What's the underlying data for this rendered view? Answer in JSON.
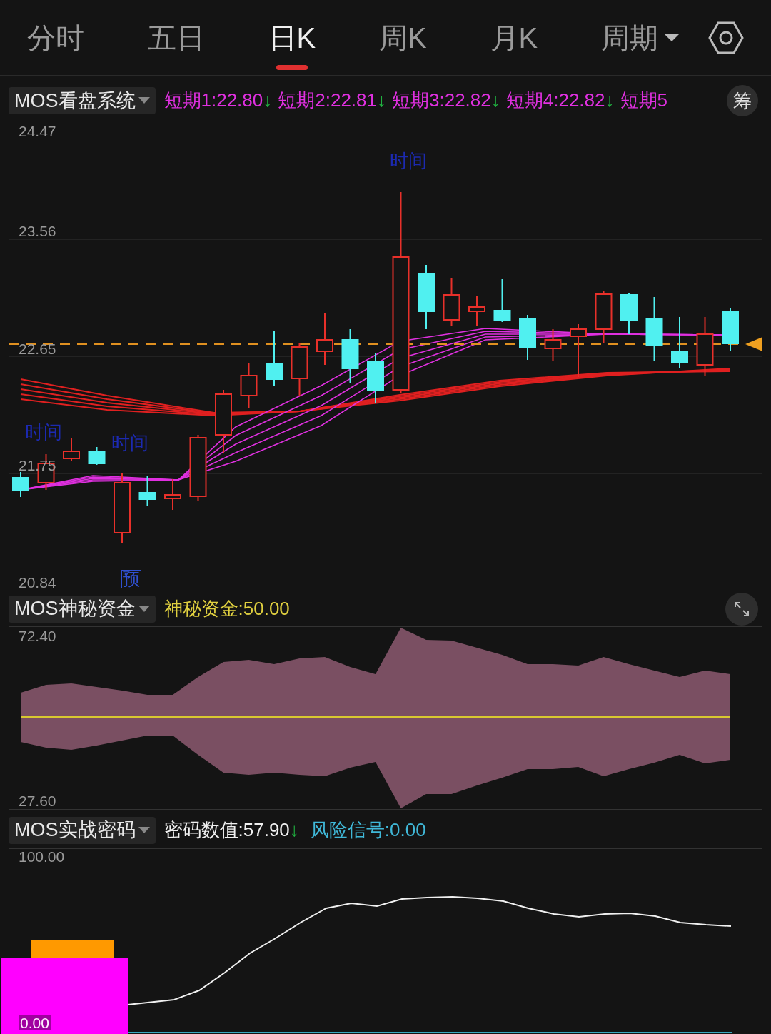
{
  "tabs": [
    {
      "label": "分时",
      "selected": false,
      "kind": "tab"
    },
    {
      "label": "五日",
      "selected": false,
      "kind": "tab"
    },
    {
      "label": "日K",
      "selected": true,
      "kind": "tab"
    },
    {
      "label": "周K",
      "selected": false,
      "kind": "tab"
    },
    {
      "label": "月K",
      "selected": false,
      "kind": "tab"
    },
    {
      "label": "周期",
      "selected": false,
      "kind": "dropdown"
    }
  ],
  "panels": [
    {
      "kind": "candles",
      "selector": "MOS看盘系统",
      "side_button": "筹",
      "indicators": [
        {
          "text": "短期1:22.80",
          "arrow": "↓",
          "color": "#e030e0"
        },
        {
          "text": "短期2:22.81",
          "arrow": "↓",
          "color": "#e030e0"
        },
        {
          "text": "短期3:22.82",
          "arrow": "↓",
          "color": "#e030e0"
        },
        {
          "text": "短期4:22.82",
          "arrow": "↓",
          "color": "#e030e0"
        },
        {
          "text": "短期5",
          "color": "#e030e0"
        }
      ],
      "ticks": [
        "24.47",
        "23.56",
        "22.65",
        "21.75",
        "20.84"
      ],
      "marks": [
        {
          "text": "时间",
          "kind": "label"
        },
        {
          "text": "时间",
          "kind": "label"
        },
        {
          "text": "时间",
          "kind": "label"
        },
        {
          "text": "预",
          "kind": "boxed"
        }
      ]
    },
    {
      "kind": "band",
      "selector": "MOS神秘资金",
      "indicators": [
        {
          "text": "神秘资金:50.00",
          "color": "#e0d040"
        }
      ],
      "ticks": [
        "72.40",
        "27.60"
      ]
    },
    {
      "kind": "line",
      "selector": "MOS实战密码",
      "indicators": [
        {
          "text": "密码数值:57.90",
          "arrow": "↓",
          "color": "#f0f0f0"
        },
        {
          "text": "风险信号:0.00",
          "color": "#40b8d8"
        }
      ],
      "ticks": [
        "100.00",
        "0.00"
      ]
    }
  ]
}
